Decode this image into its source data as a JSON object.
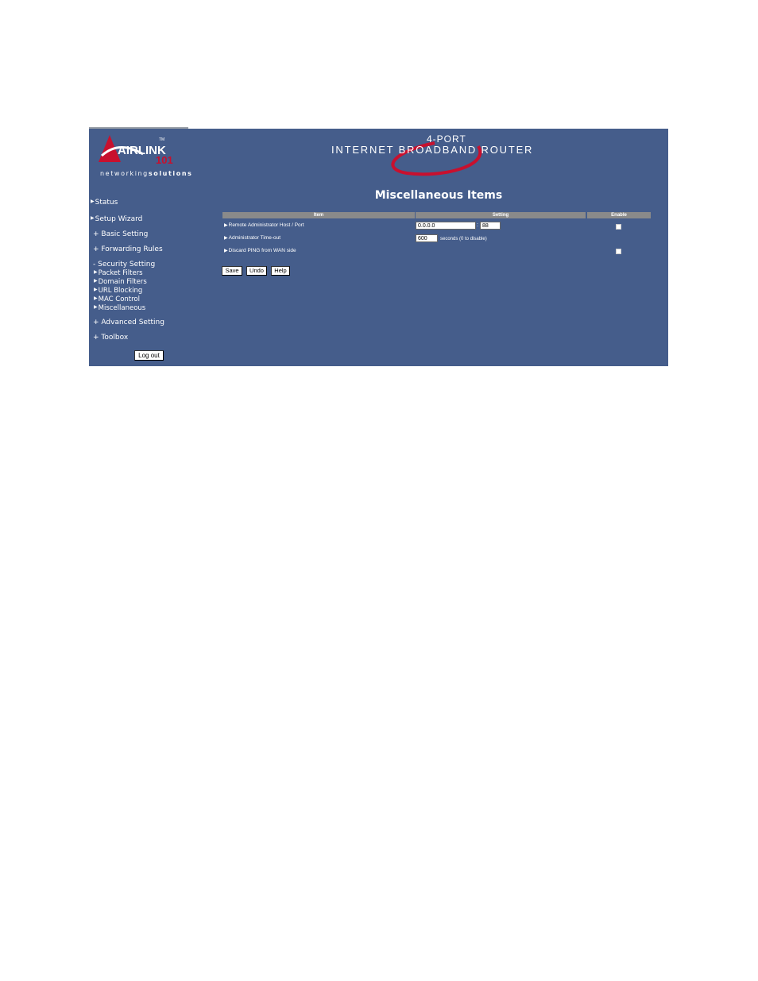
{
  "logo": {
    "brand": "AIRLINK",
    "number": "101",
    "tm": "TM",
    "tagline_a": "networking",
    "tagline_b": "solutions"
  },
  "banner": {
    "subtitle": "4-PORT",
    "title": "INTERNET BROADBAND ROUTER"
  },
  "nav": {
    "status": "Status",
    "setup_wizard": "Setup Wizard",
    "basic_setting": "+ Basic Setting",
    "forwarding_rules": "+ Forwarding Rules",
    "security_setting": "- Security Setting",
    "packet_filters": "Packet Filters",
    "domain_filters": "Domain Filters",
    "url_blocking": "URL Blocking",
    "mac_control": "MAC Control",
    "miscellaneous": "Miscellaneous",
    "advanced_setting": "+ Advanced Setting",
    "toolbox": "+ Toolbox",
    "logout": "Log out"
  },
  "main": {
    "title": "Miscellaneous Items",
    "columns": {
      "item": "Item",
      "setting": "Setting",
      "enable": "Enable"
    },
    "rows": [
      {
        "label": "Remote Administrator Host / Port",
        "host": "0.0.0.0",
        "sep": ":",
        "port": "88",
        "enabled": false
      },
      {
        "label": "Administrator Time-out",
        "value": "600",
        "hint": "seconds (0 to disable)"
      },
      {
        "label": "Discard PING from WAN side",
        "enabled": false
      }
    ],
    "buttons": {
      "save": "Save",
      "undo": "Undo",
      "help": "Help"
    }
  },
  "colors": {
    "background": "#455d8b",
    "header": "#8a8a8a",
    "accent": "#c8102e"
  }
}
